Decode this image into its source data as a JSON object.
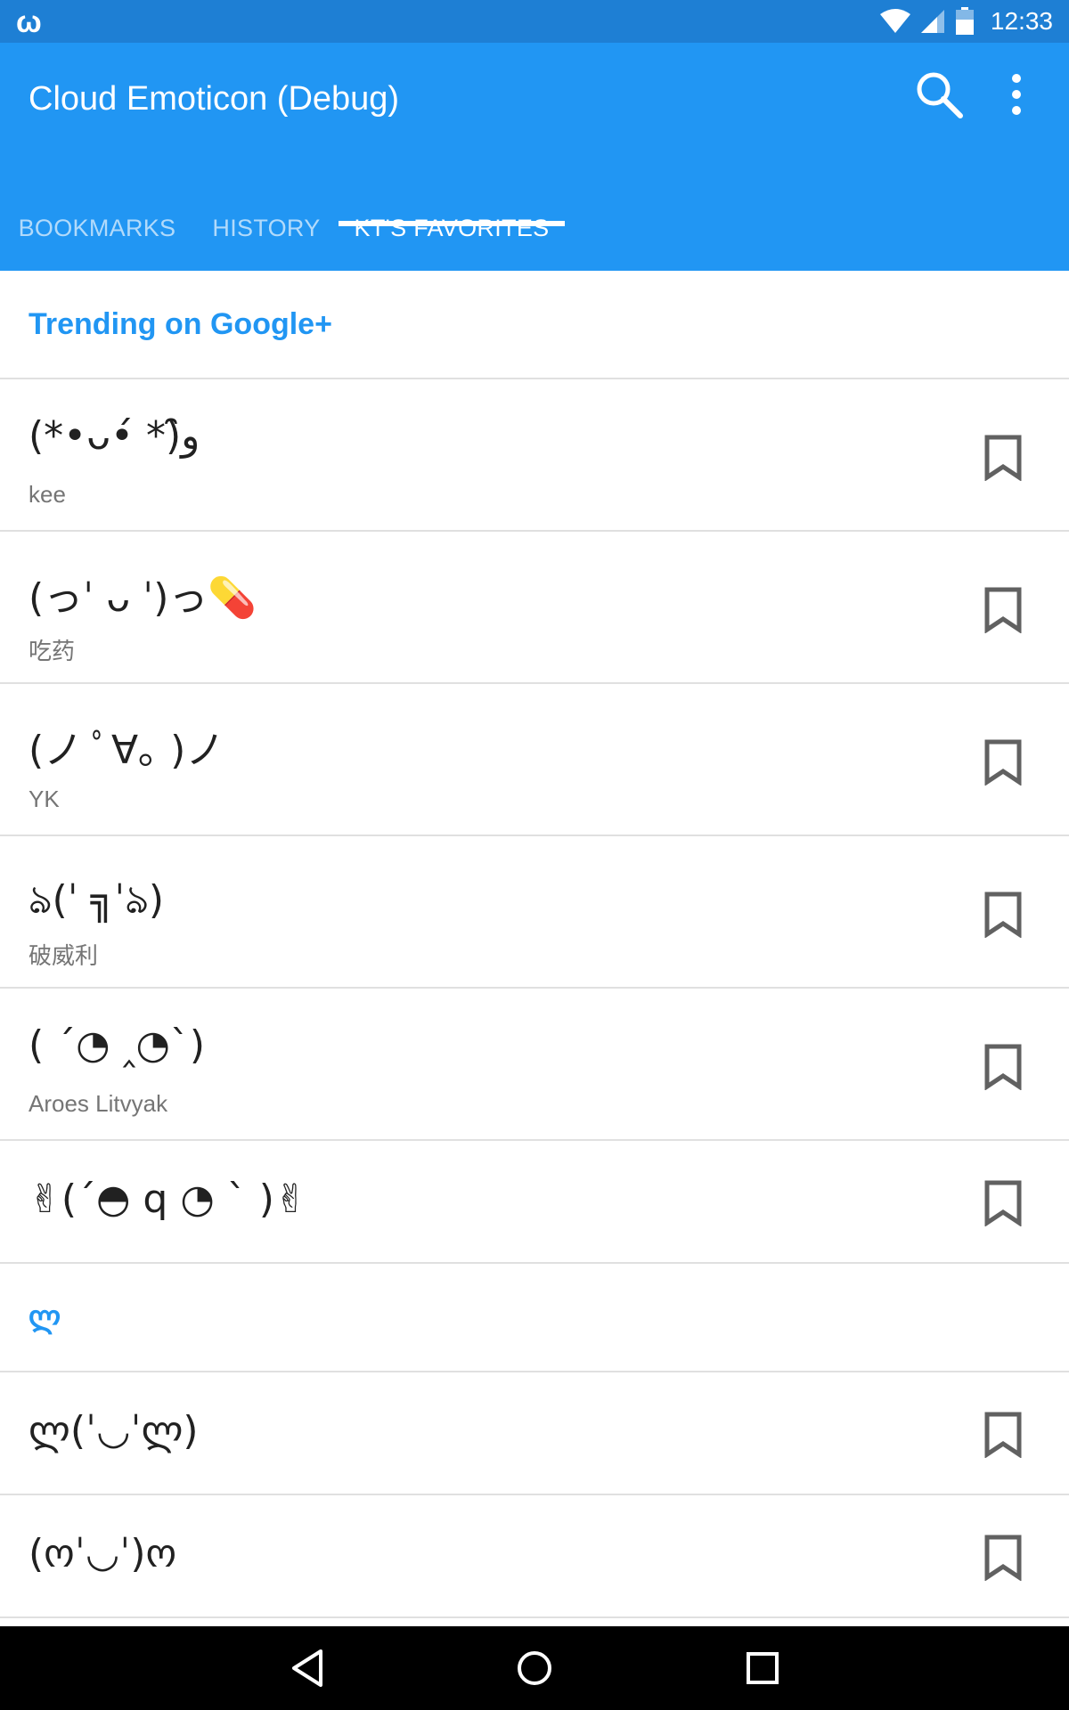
{
  "status_bar": {
    "app_icon": "w-notification-icon",
    "time": "12:33",
    "icons": [
      "wifi-icon",
      "signal-icon",
      "battery-icon"
    ]
  },
  "app_bar": {
    "title": "Cloud Emoticon (Debug)",
    "actions": [
      "search-icon",
      "more-vert-icon"
    ]
  },
  "tabs": [
    {
      "label": "BOOKMARKS",
      "active": false
    },
    {
      "label": "HISTORY",
      "active": false
    },
    {
      "label": "KT'S FAVORITES",
      "active": true
    }
  ],
  "sections": [
    {
      "header": "Trending on Google+",
      "items": [
        {
          "emoticon": "(*•ᴗ•́ *)ﻭ̑̑",
          "description": "kee"
        },
        {
          "emoticon": "(っˈ ᴗ ˈ)っ💊",
          "description": "吃药"
        },
        {
          "emoticon": "(ノ ﾟ∀｡ )ノ",
          "description": "YK"
        },
        {
          "emoticon": "ঌ(ˈ ╗ˈঌ)",
          "description": "破威利"
        },
        {
          "emoticon": "( ´◔ ‸◔`)",
          "description": "Aroes Litvyak"
        },
        {
          "emoticon": "✌(´◓ q ◔ ` )✌",
          "description": ""
        }
      ]
    },
    {
      "header": "ლ",
      "items": [
        {
          "emoticon": "ლ(ˈ◡ˈლ)",
          "description": ""
        },
        {
          "emoticon": "(ოˈ◡ˈ)ო",
          "description": ""
        }
      ]
    }
  ],
  "nav_bar": [
    "back-icon",
    "home-icon",
    "recents-icon"
  ],
  "colors": {
    "status_bar": "#1e7fd4",
    "primary": "#2196f3",
    "divider": "#e0e0e0",
    "secondary_text": "#757575"
  }
}
